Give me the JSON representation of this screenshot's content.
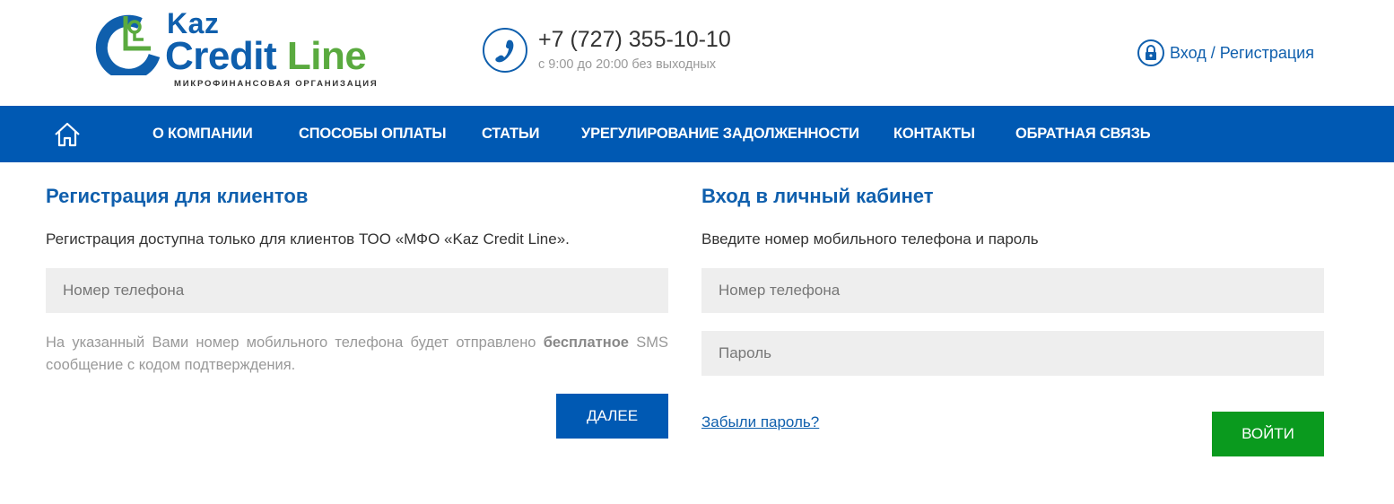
{
  "logo": {
    "kaz": "Kaz",
    "credit": "Credit",
    "line": "Line",
    "subtitle": "МИКРОФИНАНСОВАЯ ОРГАНИЗАЦИЯ"
  },
  "contact": {
    "phone": "+7 (727) 355-10-10",
    "hours": "с 9:00 до 20:00 без выходных",
    "phone_icon": "phone-icon"
  },
  "header": {
    "login_label": "Вход / Регистрация",
    "lock_icon": "lock-icon"
  },
  "nav": {
    "home_icon": "home-icon",
    "items": [
      {
        "label": "О КОМПАНИИ"
      },
      {
        "label": "СПОСОБЫ ОПЛАТЫ"
      },
      {
        "label": "СТАТЬИ"
      },
      {
        "label": "УРЕГУЛИРОВАНИЕ ЗАДОЛЖЕННОСТИ"
      },
      {
        "label": "КОНТАКТЫ"
      },
      {
        "label": "ОБРАТНАЯ СВЯЗЬ"
      }
    ]
  },
  "registration": {
    "title": "Регистрация для клиентов",
    "description": "Регистрация доступна только для клиентов ТОО «МФО «Kaz Credit Line».",
    "phone_placeholder": "Номер телефона",
    "phone_value": "",
    "note_before": "На указанный Вами номер мобильного телефона будет отправлено ",
    "note_bold": "бесплатное",
    "note_after": " SMS сообщение с кодом подтверждения.",
    "next_button": "ДАЛЕЕ"
  },
  "login": {
    "title": "Вход в личный кабинет",
    "description": "Введите номер мобильного телефона и пароль",
    "phone_placeholder": "Номер телефона",
    "phone_value": "",
    "password_placeholder": "Пароль",
    "password_value": "",
    "forgot_label": "Забыли пароль?",
    "login_button": "ВОЙТИ"
  },
  "colors": {
    "brand_blue": "#0f5fad",
    "nav_blue": "#0059b3",
    "brand_green": "#5aaa3f",
    "login_green": "#0a9a1e",
    "input_bg": "#eeeeee"
  }
}
